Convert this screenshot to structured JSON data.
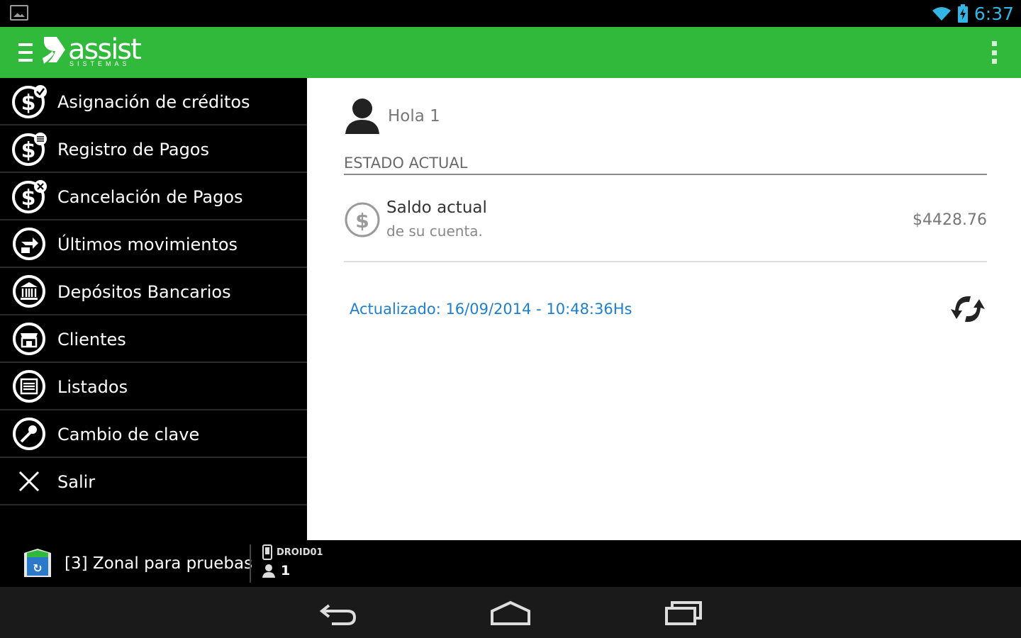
{
  "status_bar": {
    "time": "6:37",
    "icons": [
      "image-notification-icon",
      "wifi-icon",
      "battery-charging-icon"
    ]
  },
  "app_bar": {
    "logo_text": "assist",
    "logo_subtext": "SISTEMAS",
    "brand_color": "#30b93a"
  },
  "drawer": {
    "items": [
      {
        "label": "Asignación de créditos",
        "icon": "credit-assign-icon"
      },
      {
        "label": "Registro de Pagos",
        "icon": "payment-register-icon"
      },
      {
        "label": "Cancelación de Pagos",
        "icon": "payment-cancel-icon"
      },
      {
        "label": "Últimos movimientos",
        "icon": "movements-icon"
      },
      {
        "label": "Depósitos Bancarios",
        "icon": "bank-icon"
      },
      {
        "label": "Clientes",
        "icon": "clients-icon"
      },
      {
        "label": "Listados",
        "icon": "list-icon"
      },
      {
        "label": "Cambio de clave",
        "icon": "key-icon"
      },
      {
        "label": "Salir",
        "icon": "close-icon"
      }
    ]
  },
  "main": {
    "greeting": "Hola 1",
    "section_title": "ESTADO ACTUAL",
    "balance": {
      "title": "Saldo actual",
      "subtitle": "de su cuenta.",
      "amount": "$4428.76"
    },
    "updated_text": "Actualizado: 16/09/2014 - 10:48:36Hs",
    "link_color": "#1e7fd0"
  },
  "footer": {
    "zone": "[3] Zonal para pruebas",
    "device": "DROID01",
    "user": "1"
  },
  "nav_bar": {
    "buttons": [
      "back-icon",
      "home-icon",
      "recents-icon"
    ]
  }
}
